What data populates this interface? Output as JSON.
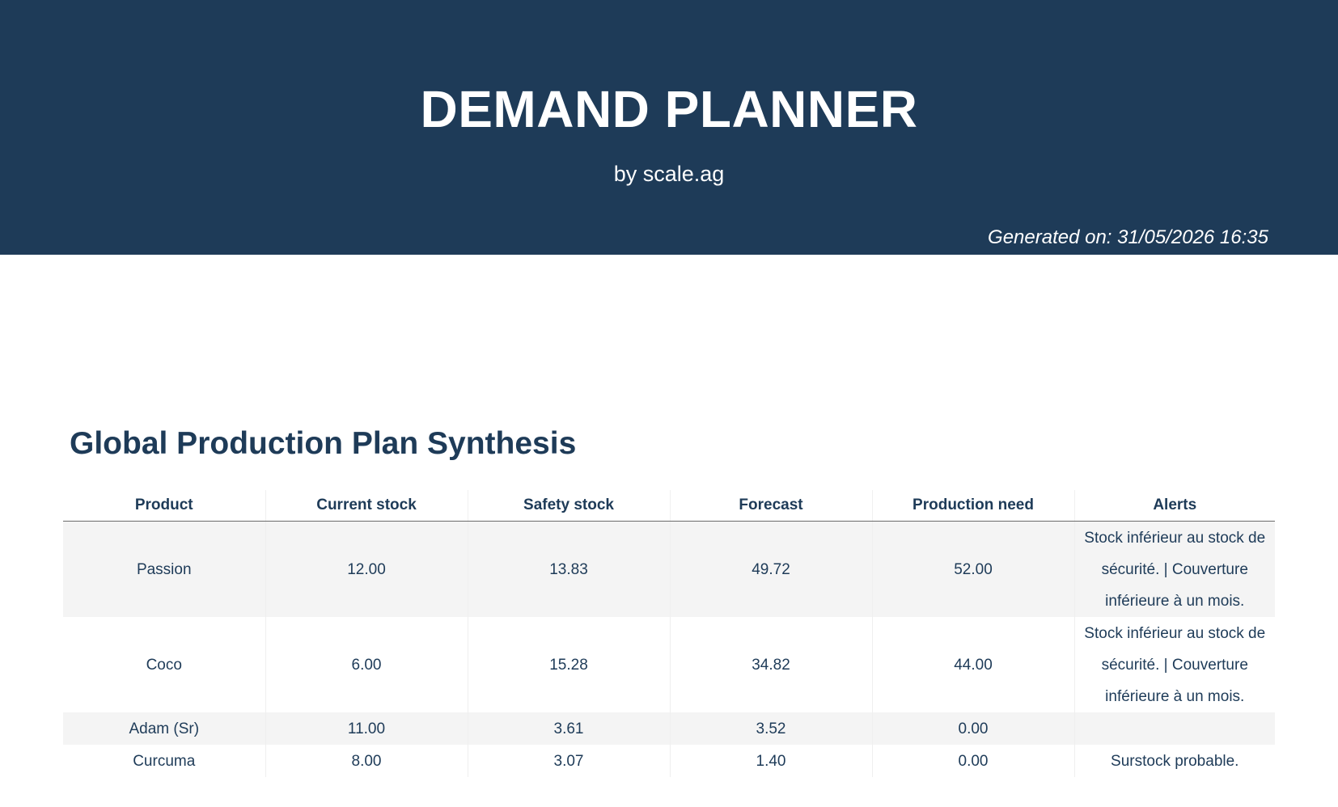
{
  "header": {
    "title": "DEMAND PLANNER",
    "subtitle": "by scale.ag",
    "generated": "Generated on: 31/05/2026 16:35"
  },
  "section": {
    "title": "Global Production Plan Synthesis"
  },
  "table": {
    "columns": [
      "Product",
      "Current stock",
      "Safety stock",
      "Forecast",
      "Production need",
      "Alerts"
    ],
    "rows": [
      [
        "Passion",
        "12.00",
        "13.83",
        "49.72",
        "52.00",
        "Stock inférieur au stock de sécurité. | Couverture inférieure à un mois."
      ],
      [
        "Coco",
        "6.00",
        "15.28",
        "34.82",
        "44.00",
        "Stock inférieur au stock de sécurité. | Couverture inférieure à un mois."
      ],
      [
        "Adam (Sr)",
        "11.00",
        "3.61",
        "3.52",
        "0.00",
        ""
      ],
      [
        "Curcuma",
        "8.00",
        "3.07",
        "1.40",
        "0.00",
        "Surstock probable."
      ]
    ]
  },
  "colors": {
    "header_bg": "#1e3b58",
    "text_primary": "#1e3b58",
    "row_shade": "#f4f4f4"
  }
}
